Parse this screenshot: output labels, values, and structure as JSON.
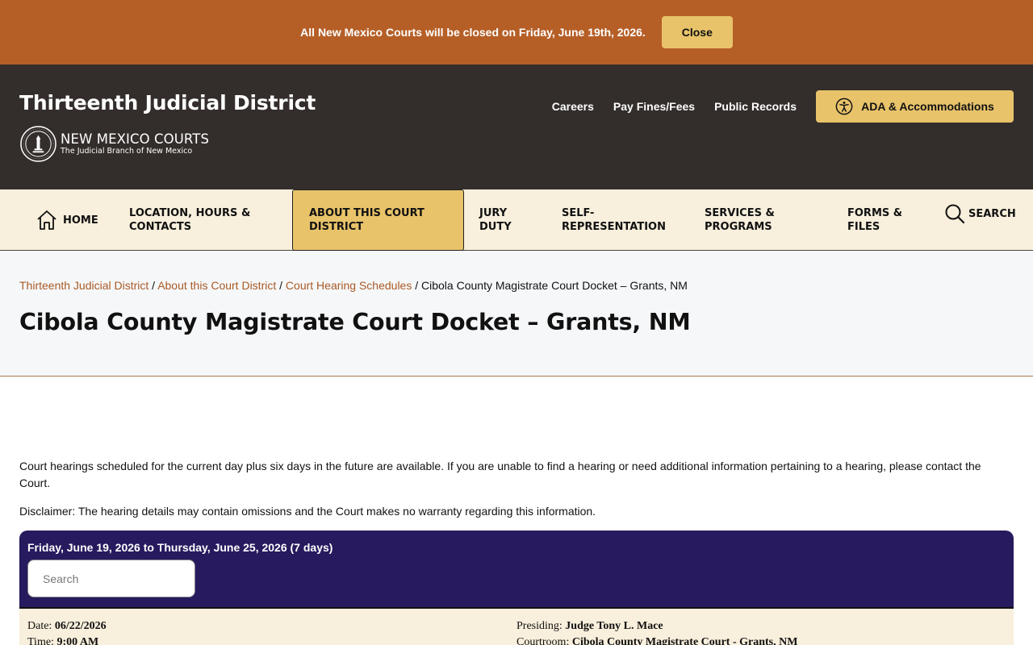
{
  "alert": {
    "message": "All New Mexico Courts will be closed on Friday, June 19th, 2026.",
    "close_label": "Close"
  },
  "header": {
    "site_title": "Thirteenth Judicial District",
    "brand_name": "NEW MEXICO COURTS",
    "brand_tagline": "The Judicial Branch of New Mexico",
    "links": [
      "Careers",
      "Pay Fines/Fees",
      "Public Records"
    ],
    "ada_label": "ADA & Accommodations"
  },
  "nav": {
    "home": "HOME",
    "location": "LOCATION, HOURS & CONTACTS",
    "about": "ABOUT THIS COURT DISTRICT",
    "jury": "JURY DUTY",
    "self_rep": "SELF-REPRESENTATION",
    "services": "SERVICES & PROGRAMS",
    "forms": "FORMS & FILES",
    "search": "SEARCH"
  },
  "breadcrumb": {
    "crumb1": "Thirteenth Judicial District",
    "crumb2": "About this Court District",
    "crumb3": "Court Hearing Schedules",
    "current": "Cibola County Magistrate Court Docket – Grants, NM",
    "sep": "/"
  },
  "page": {
    "title": "Cibola County Magistrate Court Docket – Grants, NM",
    "intro": "Court hearings scheduled for the current day plus six days in the future are available. If you are unable to find a hearing or need additional information pertaining to a hearing, please contact the Court.",
    "disclaimer": "Disclaimer:  The hearing details may contain omissions and the Court makes no warranty regarding this information."
  },
  "docket": {
    "range": "Friday, June 19, 2026 to Thursday, June 25, 2026 (7 days)",
    "search_placeholder": "Search",
    "hearing": {
      "date_label": "Date:",
      "date": "06/22/2026",
      "time_label": "Time:",
      "time": "9:00 AM",
      "presiding_label": "Presiding:",
      "presiding": "Judge Tony L. Mace",
      "courtroom_label": "Courtroom:",
      "courtroom": "Cibola County Magistrate Court - Grants, NM"
    }
  },
  "colors": {
    "alert_bg": "#b55f27",
    "header_bg": "#332e2b",
    "accent": "#e8c36a",
    "nav_bg": "#f8efdc",
    "docket_bg": "#271a5e",
    "link": "#a85a26"
  }
}
